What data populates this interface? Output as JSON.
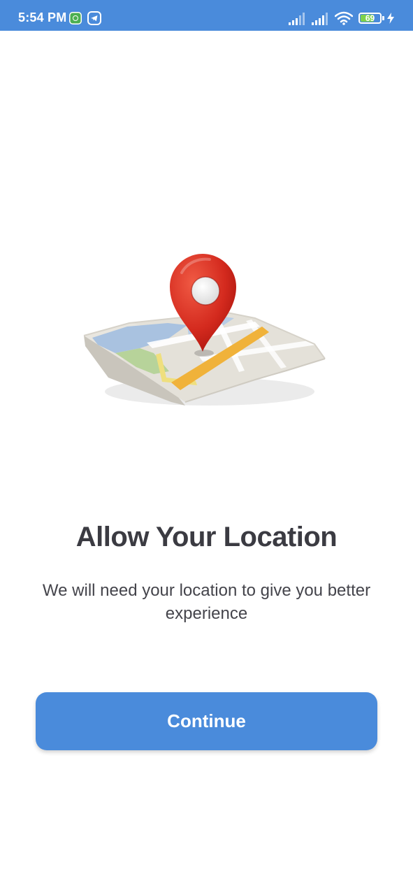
{
  "status_bar": {
    "time": "5:54 PM",
    "battery_level": "69",
    "battery_fraction": 0.69,
    "background_color": "#4a8bdb",
    "icons": [
      "app-notification-icon",
      "telegram-icon",
      "signal-icon",
      "signal-icon",
      "wifi-icon",
      "battery-icon",
      "charging-icon"
    ]
  },
  "illustration": {
    "icon": "map-location-pin-illustration",
    "pin_color": "#d42a1e",
    "road_color": "#f0b23a"
  },
  "main": {
    "title": "Allow Your Location",
    "description": "We will need your location to give you better experience"
  },
  "actions": {
    "continue_label": "Continue",
    "button_color": "#4a8bdb"
  }
}
